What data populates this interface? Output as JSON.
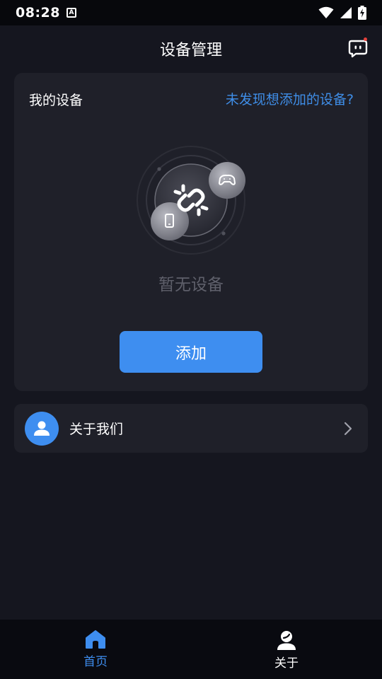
{
  "status_bar": {
    "time": "08:28",
    "notification_badge": "A"
  },
  "header": {
    "title": "设备管理",
    "message_icon": "chat-bubble-icon",
    "notification_dot_color": "#e5413c"
  },
  "devices_card": {
    "title": "我的设备",
    "help_link": "未发现想添加的设备?",
    "empty_state_text": "暂无设备",
    "add_button_label": "添加",
    "illustration_icons": [
      "broken-link-icon",
      "gamepad-icon",
      "phone-icon"
    ]
  },
  "about_row": {
    "label": "关于我们",
    "icon": "user-icon"
  },
  "bottom_nav": {
    "items": [
      {
        "label": "首页",
        "icon": "home-icon",
        "active": true
      },
      {
        "label": "关于",
        "icon": "person-icon",
        "active": false
      }
    ]
  },
  "colors": {
    "accent": "#3e8ef0",
    "background": "#15161f",
    "card": "#1f2029",
    "link": "#3f8ee8"
  }
}
